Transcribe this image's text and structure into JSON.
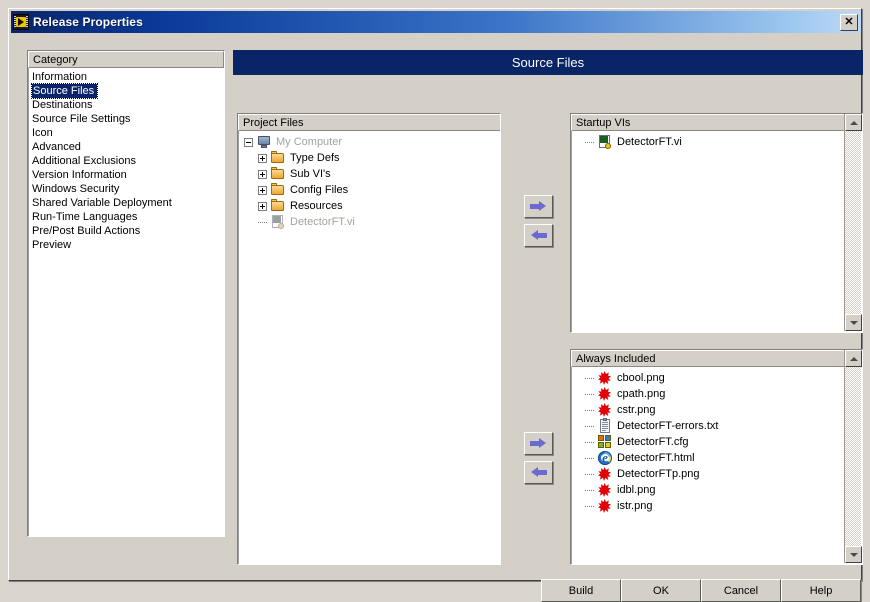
{
  "window": {
    "title": "Release Properties",
    "close_label": "✕",
    "app_icon": "labview-vi-icon"
  },
  "category": {
    "header": "Category",
    "selected": "Source Files",
    "items": [
      "Information",
      "Source Files",
      "Destinations",
      "Source File Settings",
      "Icon",
      "Advanced",
      "Additional Exclusions",
      "Version Information",
      "Windows Security",
      "Shared Variable Deployment",
      "Run-Time Languages",
      "Pre/Post Build Actions",
      "Preview"
    ]
  },
  "banner": {
    "title": "Source Files"
  },
  "project_files": {
    "header": "Project Files",
    "nodes": [
      {
        "label": "My Computer",
        "icon": "computer-icon",
        "level": 0,
        "expander": "minus",
        "dim": true
      },
      {
        "label": "Type Defs",
        "icon": "folder-icon",
        "level": 1,
        "expander": "plus",
        "dim": false
      },
      {
        "label": "Sub VI's",
        "icon": "folder-icon",
        "level": 1,
        "expander": "plus",
        "dim": false
      },
      {
        "label": "Config Files",
        "icon": "folder-icon",
        "level": 1,
        "expander": "plus",
        "dim": false
      },
      {
        "label": "Resources",
        "icon": "folder-icon",
        "level": 1,
        "expander": "plus",
        "dim": false
      },
      {
        "label": "DetectorFT.vi",
        "icon": "vi-icon",
        "level": 1,
        "expander": "none",
        "dim": true
      }
    ]
  },
  "startup_vis": {
    "header": "Startup VIs",
    "items": [
      {
        "label": "DetectorFT.vi",
        "icon": "vi-icon"
      }
    ]
  },
  "always_included": {
    "header": "Always Included",
    "items": [
      {
        "label": "cbool.png",
        "icon": "png-icon"
      },
      {
        "label": "cpath.png",
        "icon": "png-icon"
      },
      {
        "label": "cstr.png",
        "icon": "png-icon"
      },
      {
        "label": "DetectorFT-errors.txt",
        "icon": "txt-icon"
      },
      {
        "label": "DetectorFT.cfg",
        "icon": "cfg-icon"
      },
      {
        "label": "DetectorFT.html",
        "icon": "html-icon"
      },
      {
        "label": "DetectorFTp.png",
        "icon": "png-icon"
      },
      {
        "label": "idbl.png",
        "icon": "png-icon"
      },
      {
        "label": "istr.png",
        "icon": "png-icon"
      }
    ]
  },
  "transfer": {
    "add_startup": "add-to-startup-vis",
    "remove_startup": "remove-from-startup-vis",
    "add_included": "add-to-always-included",
    "remove_included": "remove-from-always-included"
  },
  "buttons": {
    "build": "Build",
    "ok": "OK",
    "cancel": "Cancel",
    "help": "Help"
  },
  "colors": {
    "window_face": "#d4d0c8",
    "banner_navy": "#0a2468",
    "selection_navy": "#0a246a",
    "title_gradient_start": "#0a246a",
    "title_gradient_end": "#bcd9f5",
    "arrow_blue": "#6a6ad0",
    "disabled_text": "#a4a29c"
  }
}
